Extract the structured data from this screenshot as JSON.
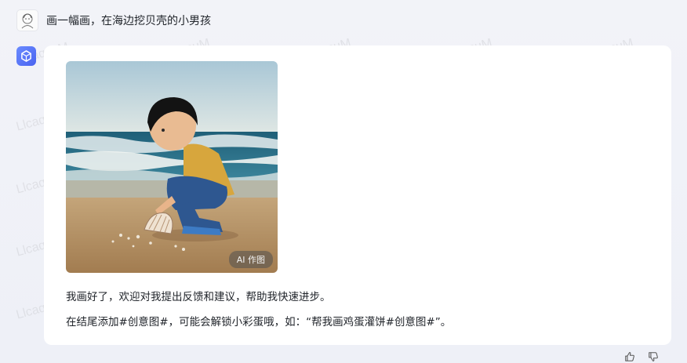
{
  "user": {
    "message": "画一幅画，在海边挖贝壳的小男孩"
  },
  "bot": {
    "image": {
      "badge": "AI 作图",
      "subject": "boy-digging-shells-on-beach"
    },
    "reply_lines": [
      "我画好了，欢迎对我提出反馈和建议，帮助我快速进步。",
      "在结尾添加#创意图#，可能会解锁小彩蛋哦，如：“帮我画鸡蛋灌饼#创意图#”。"
    ]
  },
  "actions": {
    "like_icon": "thumbs-up-icon",
    "dislike_icon": "thumbs-down-icon"
  },
  "watermark_text": "LlcaqcuM",
  "colors": {
    "page_bg": "#f2f3f8",
    "bubble_bg": "#ffffff",
    "bot_avatar": "#5a76f6"
  }
}
